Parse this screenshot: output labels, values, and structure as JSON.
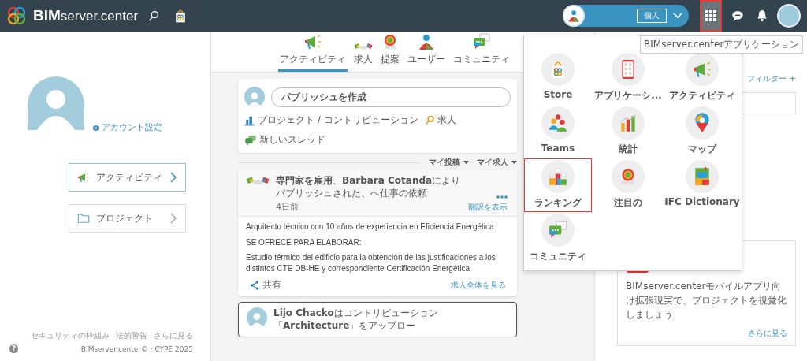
{
  "header": {
    "logo": "**BIM**server.center",
    "profile_label": "個人",
    "apps_selected": true,
    "tooltip": "BIMserver.centerアプリケーション"
  },
  "feed_tabs": [
    {
      "label": "アクティビティ",
      "kind": "megaphone",
      "selected": true
    },
    {
      "label": "求人",
      "kind": "handshake",
      "selected": false
    },
    {
      "label": "提案",
      "kind": "badge",
      "selected": false
    },
    {
      "label": "ユーザー",
      "kind": "user",
      "selected": false
    },
    {
      "label": "コミュニティ",
      "kind": "chat",
      "selected": false
    }
  ],
  "sidebar": {
    "account_link": "アカウント設定",
    "nav": [
      {
        "label": "アクティビティ",
        "kind": "megaphone",
        "selected": true
      },
      {
        "label": "プロジェクト",
        "kind": "folder",
        "selected": false
      }
    ],
    "footer_links": [
      "セキュリティの枠組み",
      "法的警告",
      "さらに見る"
    ],
    "copyright": "BIMserver.center© · CYPE 2025"
  },
  "composer": {
    "placeholder": "パブリッシュを作成",
    "actions": [
      {
        "label": "プロジェクト / コントリビューション",
        "kind": "project"
      },
      {
        "label": "求人",
        "kind": "job"
      },
      {
        "label": "新しいスレッド",
        "kind": "thread"
      }
    ]
  },
  "filters": [
    "マイ投稿",
    "マイ求人"
  ],
  "help": "?",
  "post": {
    "title": "**専門家を雇用**、**Barbara Cotanda**によりパブリッシュされた、へ仕事の依頼",
    "time": "4日前",
    "translate": "翻訳を表示",
    "body": [
      "Arquitecto técnico con 10 años de experiencia en Eficiencia Energética",
      "SE OFRECE PARA ELABORAR:",
      "Estudio térmico del edificio para la obtención de las justificaciones a los distintos CTE DB-HE y correspondiente Certificación Energética"
    ],
    "share": "共有",
    "view_all": "求人全体を見る"
  },
  "next_post": {
    "title": "**Lijo Chacko**はコントリビューション「**Architecture**」をアップロー"
  },
  "right": {
    "filter_link": "フィルター +",
    "ar_text": "BIMserver.centerモバイルアプリ向け拡張現実で、プロジェクトを視覚化しましょう",
    "more": "さらに見る"
  },
  "apps_menu": [
    {
      "label": "Store",
      "kind": "store",
      "selected": false
    },
    {
      "label": "アプリケーシ...",
      "kind": "apps",
      "selected": false
    },
    {
      "label": "アクティビティ",
      "kind": "megaphone",
      "selected": false
    },
    {
      "label": "Teams",
      "kind": "teams",
      "selected": false
    },
    {
      "label": "統計",
      "kind": "stats",
      "selected": false
    },
    {
      "label": "マップ",
      "kind": "map",
      "selected": false
    },
    {
      "label": "ランキング",
      "kind": "ranking",
      "selected": true
    },
    {
      "label": "注目の",
      "kind": "badge",
      "selected": false
    },
    {
      "label": "IFC Dictionary",
      "kind": "dictionary",
      "selected": false
    },
    {
      "label": "コミュニティ",
      "kind": "chat",
      "selected": false
    }
  ]
}
